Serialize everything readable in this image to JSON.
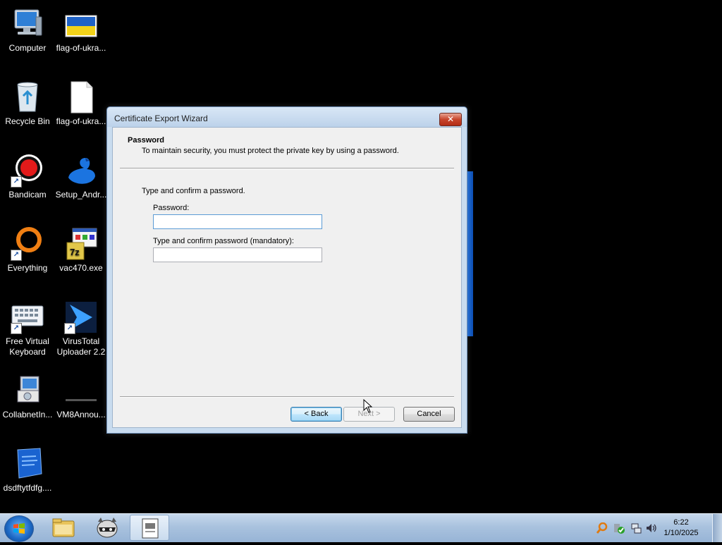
{
  "desktop": {
    "icons": [
      {
        "label": "Computer"
      },
      {
        "label": "flag-of-ukra..."
      },
      {
        "label": "Recycle Bin"
      },
      {
        "label": "flag-of-ukra..."
      },
      {
        "label": "Bandicam"
      },
      {
        "label": "Setup_Andr..."
      },
      {
        "label": "Everything"
      },
      {
        "label": "vac470.exe"
      },
      {
        "label": "Free Virtual Keyboard"
      },
      {
        "label": "VirusTotal Uploader 2.2"
      },
      {
        "label": "CollabnetIn..."
      },
      {
        "label": "VM8Annou..."
      },
      {
        "label": "dsdftytfdfg...."
      }
    ]
  },
  "dialog": {
    "title": "Certificate Export Wizard",
    "close_label": "✕",
    "header_title": "Password",
    "header_subtitle": "To maintain security, you must protect the private key by using a password.",
    "instruction": "Type and confirm a password.",
    "password_label": "Password:",
    "password_value": "",
    "confirm_label": "Type and confirm password (mandatory):",
    "confirm_value": "",
    "back_label": "< Back",
    "next_label": "Next >",
    "cancel_label": "Cancel"
  },
  "taskbar": {
    "clock_time": "6:22",
    "clock_date": "1/10/2025"
  }
}
